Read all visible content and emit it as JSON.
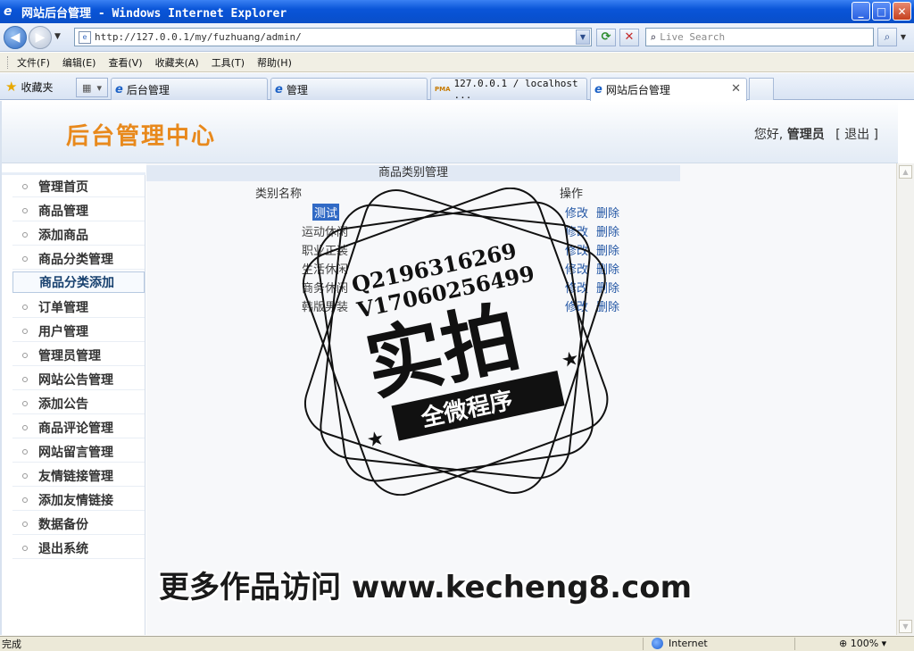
{
  "window": {
    "title": "网站后台管理 - Windows Internet Explorer",
    "controls": {
      "minimize": "_",
      "maximize": "□",
      "close": "✕"
    }
  },
  "nav": {
    "url": "http://127.0.0.1/my/fuzhuang/admin/",
    "search_placeholder": "Live Search"
  },
  "menubar": [
    "文件(F)",
    "编辑(E)",
    "查看(V)",
    "收藏夹(A)",
    "工具(T)",
    "帮助(H)"
  ],
  "favorites_label": "收藏夹",
  "tabs": [
    {
      "label": "后台管理",
      "active": false
    },
    {
      "label": "管理",
      "active": false
    },
    {
      "label": "127.0.0.1 / localhost ...",
      "active": false,
      "badge": "PMA"
    },
    {
      "label": "网站后台管理",
      "active": true
    }
  ],
  "header": {
    "logo": "后台管理中心",
    "greeting": "您好,",
    "user": "管理员",
    "logout": "[ 退出 ]"
  },
  "sidebar": {
    "items": [
      {
        "label": "管理首页"
      },
      {
        "label": "商品管理"
      },
      {
        "label": "添加商品"
      },
      {
        "label": "商品分类管理"
      },
      {
        "label": "商品分类添加",
        "active": true
      },
      {
        "label": "订单管理"
      },
      {
        "label": "用户管理"
      },
      {
        "label": "管理员管理"
      },
      {
        "label": "网站公告管理"
      },
      {
        "label": "添加公告"
      },
      {
        "label": "商品评论管理"
      },
      {
        "label": "网站留言管理"
      },
      {
        "label": "友情链接管理"
      },
      {
        "label": "添加友情链接"
      },
      {
        "label": "数据备份"
      },
      {
        "label": "退出系统"
      }
    ]
  },
  "main": {
    "title": "商品类别管理",
    "columns": [
      "类别名称",
      "操作"
    ],
    "rows": [
      {
        "name": "测试",
        "edit": "修改",
        "del": "删除",
        "selected": true
      },
      {
        "name": "运动休闲",
        "edit": "修改",
        "del": "删除"
      },
      {
        "name": "职业正装",
        "edit": "修改",
        "del": "删除"
      },
      {
        "name": "生活休闲",
        "edit": "修改",
        "del": "删除"
      },
      {
        "name": "商务休闲",
        "edit": "修改",
        "del": "删除"
      },
      {
        "name": "韩版男装",
        "edit": "修改",
        "del": "删除"
      }
    ]
  },
  "watermark": {
    "qq": "Q2196316269",
    "wechat": "V17060256499",
    "big": "实拍",
    "ribbon": "全微程序",
    "bottom": "更多作品访问 www.kecheng8.com"
  },
  "statusbar": {
    "status": "完成",
    "zone": "Internet",
    "zoom": "100%"
  }
}
